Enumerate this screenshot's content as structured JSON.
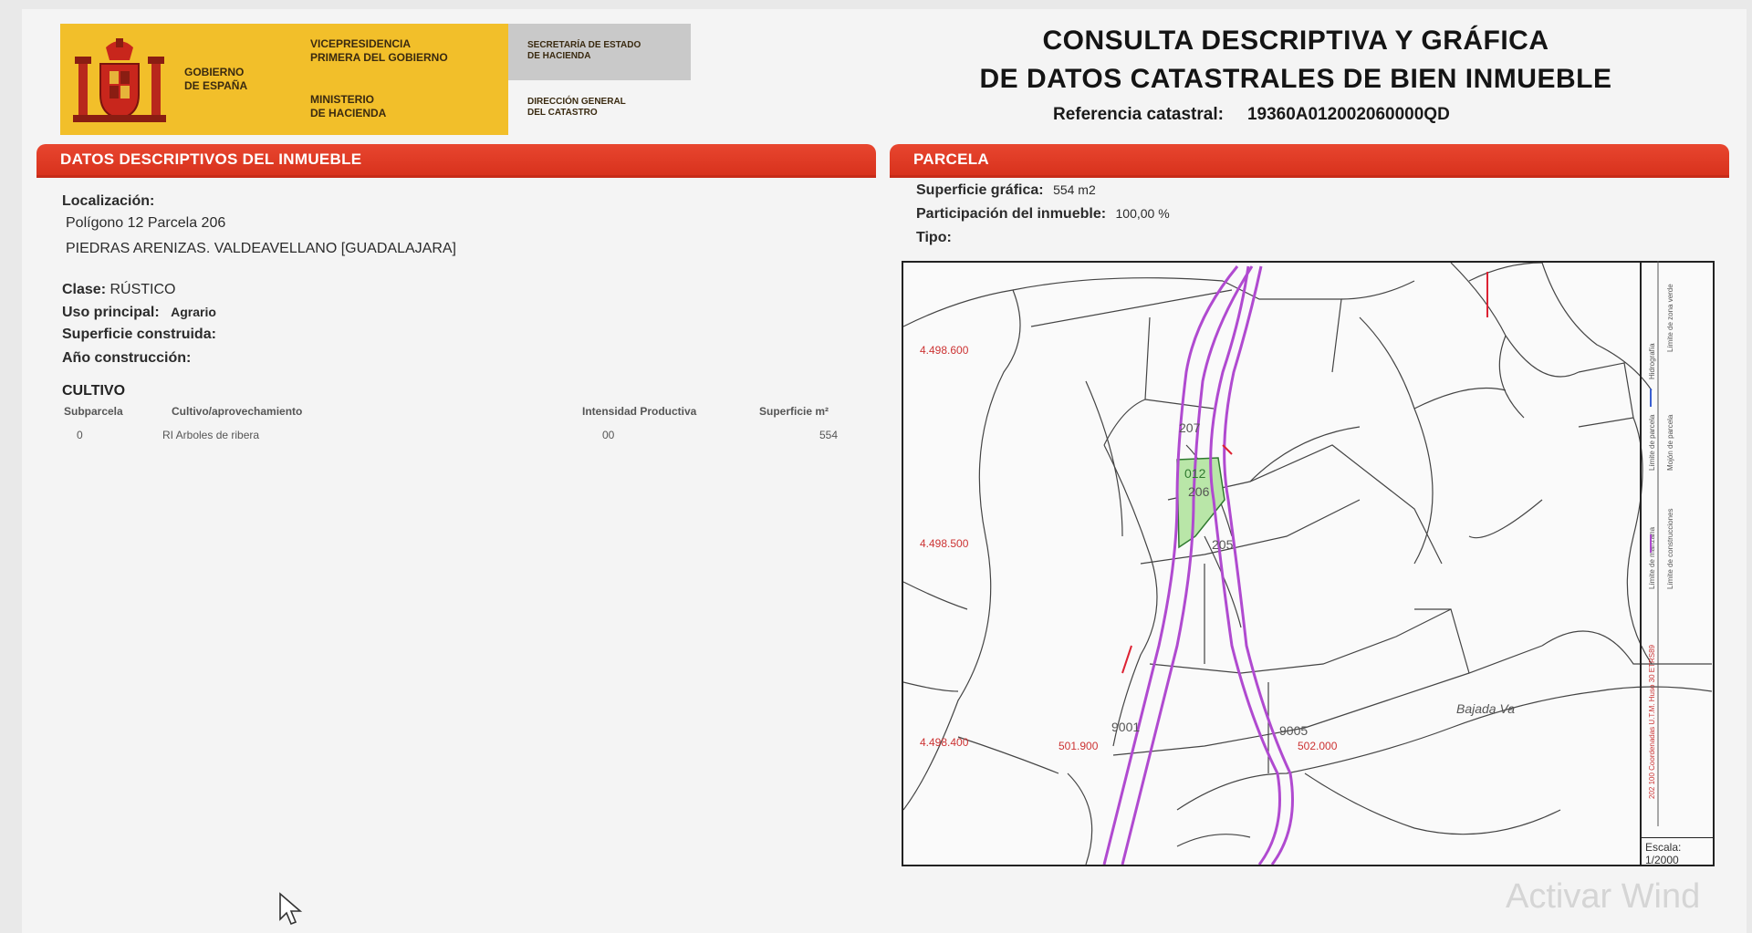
{
  "header": {
    "gov": "GOBIERNO\nDE ESPAÑA",
    "vice": "VICEPRESIDENCIA\nPRIMERA DEL GOBIERNO",
    "ministry": "MINISTERIO\nDE HACIENDA",
    "secretaria": "SECRETARÍA DE ESTADO\nDE HACIENDA",
    "direccion": "DIRECCIÓN GENERAL\nDEL CATASTRO",
    "title_line1": "CONSULTA DESCRIPTIVA Y GRÁFICA",
    "title_line2": "DE DATOS CATASTRALES DE BIEN INMUEBLE",
    "ref_label": "Referencia catastral:",
    "ref_value": "19360A012002060000QD"
  },
  "left": {
    "section_title": "DATOS DESCRIPTIVOS DEL INMUEBLE",
    "localizacion_label": "Localización:",
    "localizacion_line1": "Polígono 12 Parcela 206",
    "localizacion_line2": "PIEDRAS ARENIZAS. VALDEAVELLANO [GUADALAJARA]",
    "clase_label": "Clase:",
    "clase_value": "RÚSTICO",
    "uso_label": "Uso principal:",
    "uso_value": "Agrario",
    "superficie_label": "Superficie construida:",
    "anio_label": "Año construcción:",
    "cultivo_title": "CULTIVO",
    "cultivo_headers": [
      "Subparcela",
      "Cultivo/aprovechamiento",
      "Intensidad Productiva",
      "Superficie m²"
    ],
    "cultivo_rows": [
      {
        "subparcela": "0",
        "cultivo": "RI Arboles de ribera",
        "intensidad": "00",
        "superficie": "554"
      }
    ]
  },
  "right": {
    "section_title": "PARCELA",
    "superficie_label": "Superficie gráfica:",
    "superficie_value": "554 m2",
    "participacion_label": "Participación del inmueble:",
    "participacion_value": "100,00 %",
    "tipo_label": "Tipo:",
    "map_labels": {
      "coord_y1": "4.498.600",
      "coord_y2": "4.498.500",
      "coord_y3": "4.498.400",
      "coord_x1": "501.900",
      "coord_x2": "502.000",
      "p207": "207",
      "p012": "012",
      "p206": "206",
      "p205": "205",
      "p9001": "9001",
      "p9005": "9005",
      "place": "Bajada Va"
    },
    "legend": [
      "Hidrografía",
      "Límite de zona verde",
      "Límite de parcela",
      "Mojón de parcela",
      "Límite de manzana",
      "Límite de construcciones",
      "202 100 Coordenadas U.T.M. Huso 30 ETRS89"
    ],
    "scale_label": "Escala:",
    "scale_value": "1/2000"
  },
  "colors": {
    "bar": "#d8321d",
    "logo_yellow": "#f2bf2a",
    "parcel_fill": "#b9e6a8",
    "road": "#b04ad0"
  },
  "watermark": "Activar Wind"
}
